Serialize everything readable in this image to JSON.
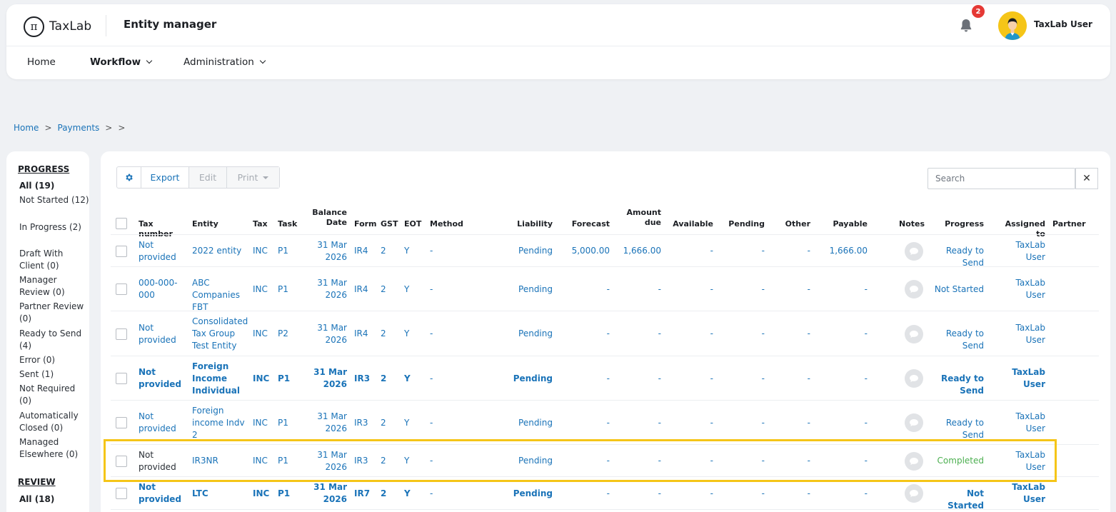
{
  "header": {
    "logo_text": "TaxLab",
    "app_title": "Entity manager",
    "notifications_count": "2",
    "user_name": "TaxLab User"
  },
  "nav": [
    {
      "label": "Home"
    },
    {
      "label": "Workflow"
    },
    {
      "label": "Administration"
    }
  ],
  "breadcrumb": {
    "home": "Home",
    "payments": "Payments",
    "sep": ">"
  },
  "sidebar": {
    "progress_title": "PROGRESS",
    "progress_filters": [
      "All (19)",
      "Not Started (12)",
      "In Progress (2)",
      "Draft With Client (0)",
      "Manager Review (0)",
      "Partner Review (0)",
      "Ready to Send (4)",
      "Error (0)",
      "Sent (1)",
      "Not Required (0)",
      "Automatically Closed (0)",
      "Managed Elsewhere (0)"
    ],
    "review_title": "REVIEW",
    "review_filters": [
      "All (18)"
    ]
  },
  "toolbar": {
    "export_label": "Export",
    "edit_label": "Edit",
    "print_label": "Print",
    "search_placeholder": "Search",
    "clear_label": "✕"
  },
  "table": {
    "headers": {
      "tax_number": "Tax number",
      "entity": "Entity",
      "tax": "Tax",
      "task": "Task",
      "balance_date": "Balance Date",
      "form": "Form",
      "gst": "GST",
      "eot": "EOT",
      "method": "Method",
      "liability": "Liability",
      "forecast": "Forecast",
      "amount_due": "Amount due",
      "available": "Available",
      "pending": "Pending",
      "other": "Other",
      "payable": "Payable",
      "notes": "Notes",
      "progress": "Progress",
      "assigned_to": "Assigned to",
      "partner": "Partner"
    },
    "rows": [
      {
        "tax_number": "Not provided",
        "entity": "2022 entity",
        "tax": "INC",
        "task": "P1",
        "balance_date": "31 Mar 2026",
        "form": "IR4",
        "gst": "2",
        "eot": "Y",
        "method": "-",
        "liability": "Pending",
        "forecast": "5,000.00",
        "amount_due": "1,666.00",
        "available": "-",
        "pending": "-",
        "other": "-",
        "payable": "1,666.00",
        "progress": "Ready to Send",
        "assigned_to": "TaxLab User"
      },
      {
        "tax_number": "000-000-000",
        "entity": "ABC Companies FBT",
        "tax": "INC",
        "task": "P1",
        "balance_date": "31 Mar 2026",
        "form": "IR4",
        "gst": "2",
        "eot": "Y",
        "method": "-",
        "liability": "Pending",
        "forecast": "-",
        "amount_due": "-",
        "available": "-",
        "pending": "-",
        "other": "-",
        "payable": "-",
        "progress": "Not Started",
        "assigned_to": "TaxLab User"
      },
      {
        "tax_number": "Not provided",
        "entity": "Consolidated Tax Group Test Entity",
        "tax": "INC",
        "task": "P2",
        "balance_date": "31 Mar 2026",
        "form": "IR4",
        "gst": "2",
        "eot": "Y",
        "method": "-",
        "liability": "Pending",
        "forecast": "-",
        "amount_due": "-",
        "available": "-",
        "pending": "-",
        "other": "-",
        "payable": "-",
        "progress": "Ready to Send",
        "assigned_to": "TaxLab User"
      },
      {
        "tax_number": "Not provided",
        "entity": "Foreign Income Individual",
        "tax": "INC",
        "task": "P1",
        "balance_date": "31 Mar 2026",
        "form": "IR3",
        "gst": "2",
        "eot": "Y",
        "method": "-",
        "liability": "Pending",
        "forecast": "-",
        "amount_due": "-",
        "available": "-",
        "pending": "-",
        "other": "-",
        "payable": "-",
        "progress": "Ready to Send",
        "assigned_to": "TaxLab User"
      },
      {
        "tax_number": "Not provided",
        "entity": "Foreign income Indv 2",
        "tax": "INC",
        "task": "P1",
        "balance_date": "31 Mar 2026",
        "form": "IR3",
        "gst": "2",
        "eot": "Y",
        "method": "-",
        "liability": "Pending",
        "forecast": "-",
        "amount_due": "-",
        "available": "-",
        "pending": "-",
        "other": "-",
        "payable": "-",
        "progress": "Ready to Send",
        "assigned_to": "TaxLab User"
      },
      {
        "tax_number": "Not provided",
        "entity": "IR3NR",
        "tax": "INC",
        "task": "P1",
        "balance_date": "31 Mar 2026",
        "form": "IR3",
        "gst": "2",
        "eot": "Y",
        "method": "-",
        "liability": "Pending",
        "forecast": "-",
        "amount_due": "-",
        "available": "-",
        "pending": "-",
        "other": "-",
        "payable": "-",
        "progress": "Completed",
        "assigned_to": "TaxLab User"
      },
      {
        "tax_number": "Not provided",
        "entity": "LTC",
        "tax": "INC",
        "task": "P1",
        "balance_date": "31 Mar 2026",
        "form": "IR7",
        "gst": "2",
        "eot": "Y",
        "method": "-",
        "liability": "Pending",
        "forecast": "-",
        "amount_due": "-",
        "available": "-",
        "pending": "-",
        "other": "-",
        "payable": "-",
        "progress": "Not Started",
        "assigned_to": "TaxLab User"
      }
    ]
  },
  "colors": {
    "link": "#1a73b8",
    "completed": "#4caf50",
    "highlight": "#f5c518",
    "badge": "#e53935"
  }
}
